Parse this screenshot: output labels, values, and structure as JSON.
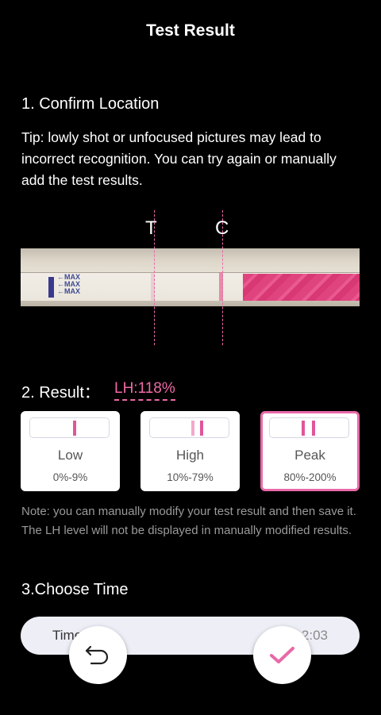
{
  "header": {
    "title": "Test Result"
  },
  "section1": {
    "heading": "1. Confirm Location",
    "tip": "Tip: lowly shot or unfocused pictures may lead to incorrect recognition. You can try again or manually add the test results."
  },
  "strip": {
    "t_label": "T",
    "c_label": "C",
    "max_lines": [
      "←MAX",
      "←MAX",
      "←MAX"
    ]
  },
  "section2": {
    "heading": "2. Result：",
    "lh_value": "LH:118%",
    "options": [
      {
        "name": "Low",
        "range": "0%-9%",
        "selected": false
      },
      {
        "name": "High",
        "range": "10%-79%",
        "selected": false
      },
      {
        "name": "Peak",
        "range": "80%-200%",
        "selected": true
      }
    ]
  },
  "note": "Note: you can manually modify your test result and then save it. The LH level will not be displayed in manually modified results.",
  "section3": {
    "heading": "3.Choose Time",
    "time_label": "Time",
    "time_value": "2:03"
  },
  "actions": {
    "back_icon": "undo-icon",
    "confirm_icon": "check-icon"
  },
  "colors": {
    "accent": "#e86aa8",
    "background": "#000000",
    "card": "#ffffff",
    "note": "#9a9a9a"
  }
}
